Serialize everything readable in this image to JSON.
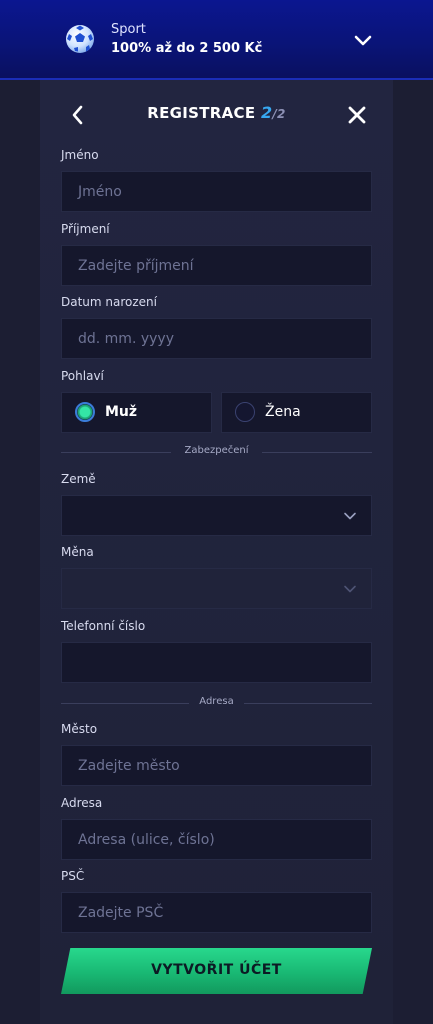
{
  "promo": {
    "title": "Sport",
    "subtitle": "100% až do 2 500 Kč"
  },
  "header": {
    "title": "REGISTRACE",
    "step": "2",
    "total": "/2"
  },
  "fields": {
    "first_name": {
      "label": "Jméno",
      "placeholder": "Jméno"
    },
    "last_name": {
      "label": "Příjmení",
      "placeholder": "Zadejte příjmení"
    },
    "birthdate": {
      "label": "Datum narození",
      "placeholder": "dd. mm. yyyy"
    },
    "gender": {
      "label": "Pohlaví",
      "options": [
        "Muž",
        "Žena"
      ],
      "selected": "Muž"
    },
    "country": {
      "label": "Země",
      "value": ""
    },
    "currency": {
      "label": "Měna",
      "value": ""
    },
    "phone": {
      "label": "Telefonní číslo",
      "value": ""
    },
    "city": {
      "label": "Město",
      "placeholder": "Zadejte město"
    },
    "address": {
      "label": "Adresa",
      "placeholder": "Adresa (ulice, číslo)"
    },
    "zip": {
      "label": "PSČ",
      "placeholder": "Zadejte PSČ"
    }
  },
  "sections": {
    "security": "Zabezpečení",
    "address": "Adresa"
  },
  "submit": {
    "label": "VYTVOŘIT ÚČET"
  },
  "colors": {
    "accent_green": "#22c982",
    "accent_blue": "#37a7f0",
    "promo_bg": "#0a1478"
  },
  "icons": [
    "soccer-ball-icon",
    "chevron-down-icon",
    "back-arrow-icon",
    "close-icon"
  ]
}
